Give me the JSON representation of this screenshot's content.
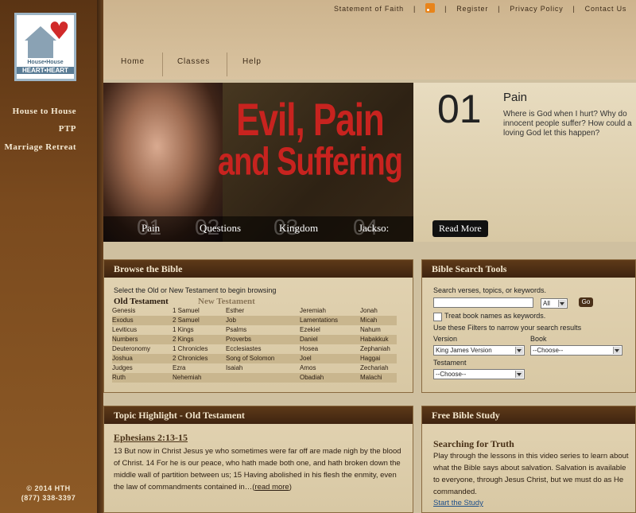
{
  "sidebar": {
    "logo": {
      "line1": "House•House",
      "line2": "HEART•HEART"
    },
    "links": [
      "House to House",
      "PTP",
      "Marriage Retreat"
    ],
    "footer": {
      "copyright": "© 2014 HTH",
      "phone": "(877) 338-3397"
    }
  },
  "toplinks": {
    "statement": "Statement of Faith",
    "register": "Register",
    "privacy": "Privacy Policy",
    "contact": "Contact Us",
    "rss_icon": "rss-icon"
  },
  "nav": {
    "home": "Home",
    "classes": "Classes",
    "help": "Help"
  },
  "hero": {
    "title_line1": "Evil, Pain",
    "title_line2": "and Suffering",
    "tabs": [
      {
        "num": "01",
        "label": "Pain"
      },
      {
        "num": "02",
        "label": "Questions"
      },
      {
        "num": "03",
        "label": "Kingdom"
      },
      {
        "num": "04",
        "label": "Jackso:"
      }
    ]
  },
  "feature": {
    "number": "01",
    "title": "Pain",
    "description": "Where is God when I hurt? Why do innocent people suffer? How could a loving God let this happen?",
    "read_more": "Read More"
  },
  "browse": {
    "title": "Browse the Bible",
    "instruction": "Select the Old or New Testament to begin browsing",
    "old_testament": "Old Testament",
    "new_testament": "New Testament",
    "rows": [
      [
        "Genesis",
        "1 Samuel",
        "Esther",
        "Jeremiah",
        "Jonah"
      ],
      [
        "Exodus",
        "2 Samuel",
        "Job",
        "Lamentations",
        "Micah"
      ],
      [
        "Leviticus",
        "1 Kings",
        "Psalms",
        "Ezekiel",
        "Nahum"
      ],
      [
        "Numbers",
        "2 Kings",
        "Proverbs",
        "Daniel",
        "Habakkuk"
      ],
      [
        "Deuteronomy",
        "1 Chronicles",
        "Ecclesiastes",
        "Hosea",
        "Zephaniah"
      ],
      [
        "Joshua",
        "2 Chronicles",
        "Song of Solomon",
        "Joel",
        "Haggai"
      ],
      [
        "Judges",
        "Ezra",
        "Isaiah",
        "Amos",
        "Zechariah"
      ],
      [
        "Ruth",
        "Nehemiah",
        "",
        "Obadiah",
        "Malachi"
      ]
    ]
  },
  "search": {
    "title": "Bible Search Tools",
    "prompt": "Search verses, topics, or keywords.",
    "query": "",
    "scope": "All",
    "go": "Go",
    "treat_label": "Treat book names as keywords.",
    "filters_label": "Use these Filters to narrow your search results",
    "version_label": "Version",
    "version_value": "King James Version",
    "book_label": "Book",
    "book_value": "--Choose--",
    "testament_label": "Testament",
    "testament_value": "--Choose--"
  },
  "topic": {
    "title": "Topic Highlight - Old Testament",
    "reference": "Ephesians 2:13-15",
    "text": "13 But now in Christ Jesus ye who sometimes were far off are made nigh by the blood of Christ. 14 For he is our peace, who hath made both one, and hath broken down the middle wall of partition between us; 15 Having abolished in his flesh the enmity, even the law of commandments contained in…(",
    "read_more": "read more",
    "close": ")"
  },
  "study": {
    "title": "Free Bible Study",
    "subtitle": "Searching for Truth",
    "text": "Play through the lessons in this video series to learn about what the Bible says about salvation. Salvation is available to everyone, through Jesus Christ, but we must do as He commanded.",
    "link": "Start the Study"
  }
}
